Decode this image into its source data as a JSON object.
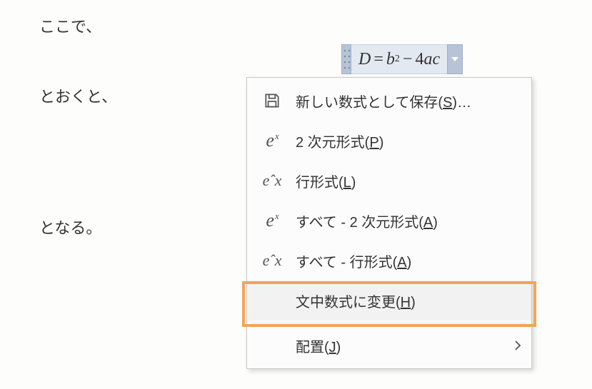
{
  "document": {
    "para1": "ここで、",
    "para2": "とおくと、",
    "para3": "となる。"
  },
  "equation": {
    "display": "D = b² − 4ac",
    "parts": {
      "D": "D",
      "eq": "=",
      "b": "b",
      "sq": "2",
      "minus": "−",
      "four": "4",
      "a": "a",
      "c": "c"
    }
  },
  "menu": {
    "save_as_new": {
      "label": "新しい数式として保存(",
      "accel": "S",
      "tail": ")…"
    },
    "professional": {
      "label": "2 次元形式(",
      "accel": "P",
      "tail": ")"
    },
    "linear": {
      "label": "行形式(",
      "accel": "L",
      "tail": ")"
    },
    "all_professional": {
      "label": "すべて - 2 次元形式(",
      "accel": "A",
      "tail": ")"
    },
    "all_linear": {
      "label": "すべて - 行形式(",
      "accel": "A",
      "tail": ")"
    },
    "change_to_inline": {
      "label": "文中数式に変更(",
      "accel": "H",
      "tail": ")"
    },
    "justification": {
      "label": "配置(",
      "accel": "J",
      "tail": ")"
    }
  }
}
